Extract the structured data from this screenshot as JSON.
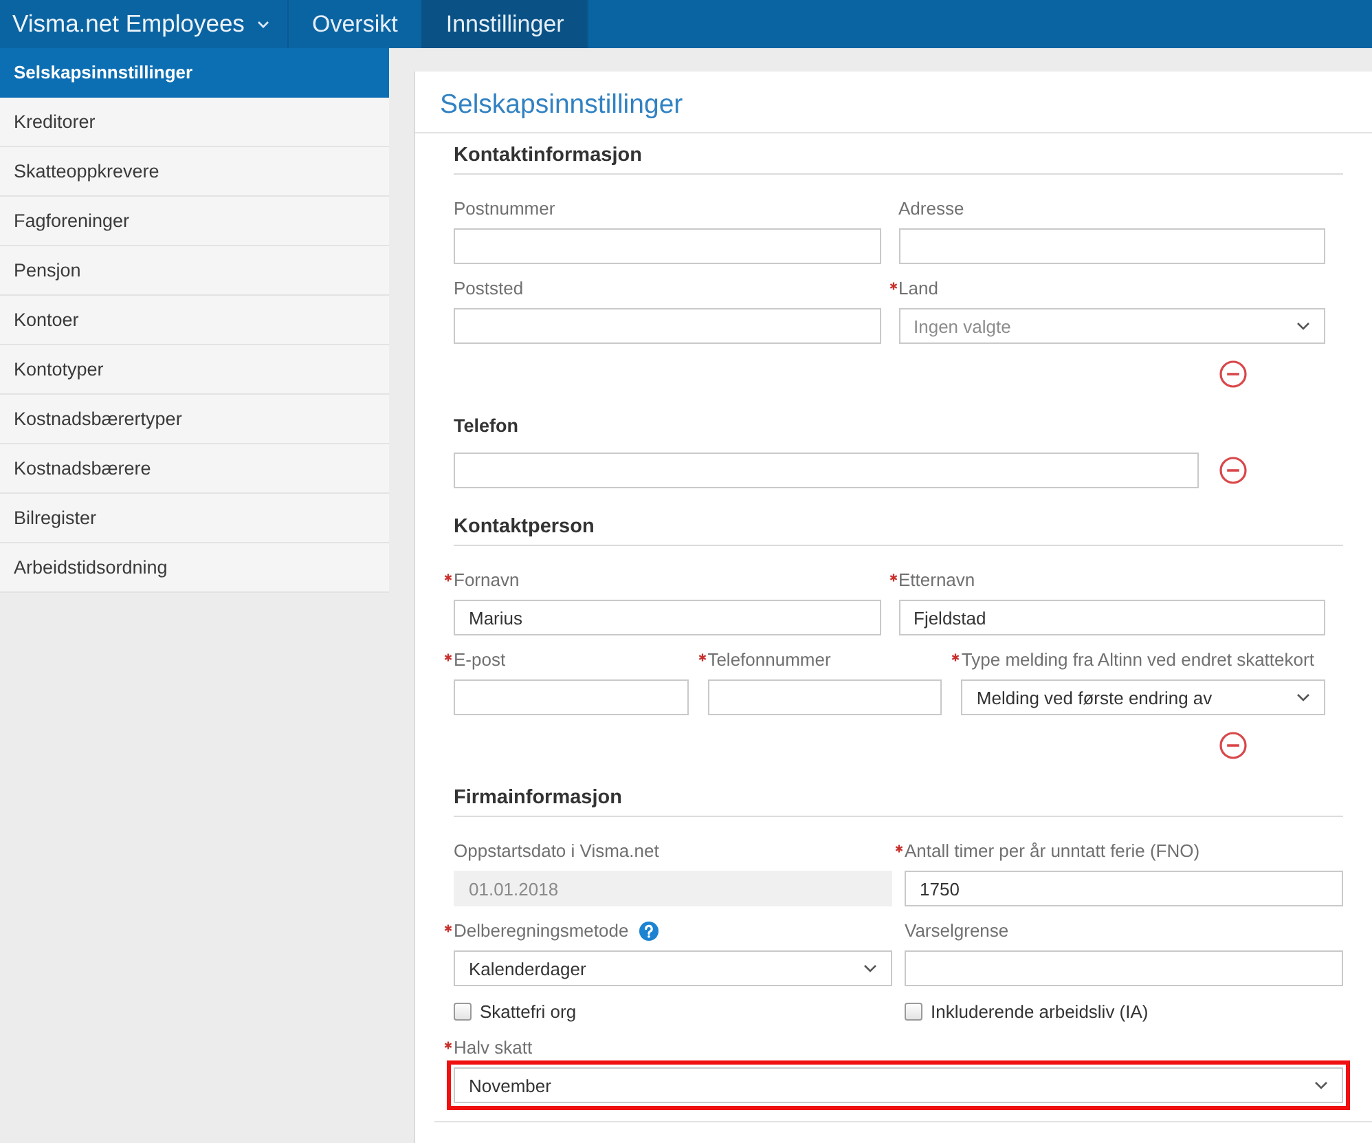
{
  "topbar": {
    "brand": "Visma.net Employees",
    "tabs": [
      {
        "label": "Oversikt",
        "selected": false
      },
      {
        "label": "Innstillinger",
        "selected": true
      }
    ]
  },
  "sidebar": {
    "items": [
      {
        "label": "Selskapsinnstillinger",
        "selected": true
      },
      {
        "label": "Kreditorer",
        "selected": false
      },
      {
        "label": "Skatteoppkrevere",
        "selected": false
      },
      {
        "label": "Fagforeninger",
        "selected": false
      },
      {
        "label": "Pensjon",
        "selected": false
      },
      {
        "label": "Kontoer",
        "selected": false
      },
      {
        "label": "Kontotyper",
        "selected": false
      },
      {
        "label": "Kostnadsbærertyper",
        "selected": false
      },
      {
        "label": "Kostnadsbærere",
        "selected": false
      },
      {
        "label": "Bilregister",
        "selected": false
      },
      {
        "label": "Arbeidstidsordning",
        "selected": false
      }
    ]
  },
  "page": {
    "title": "Selskapsinnstillinger",
    "sections": [
      {
        "kind": "group",
        "heading": "Kontaktinformasjon",
        "rows": [
          {
            "fields": [
              {
                "kind": "input",
                "label": "Postnummer",
                "required": false,
                "disabled": false
              },
              {
                "kind": "input",
                "label": "Adresse",
                "required": false,
                "disabled": false
              }
            ]
          },
          {
            "fields": [
              {
                "kind": "input",
                "label": "Poststed",
                "required": false,
                "disabled": false
              },
              {
                "kind": "select",
                "label": "Land",
                "required": true,
                "disabled": false,
                "placeholder": "Ingen valgte"
              }
            ]
          },
          {
            "fields": [
              {
                "kind": "remove"
              }
            ]
          }
        ]
      },
      {
        "kind": "subgroup",
        "heading": "Telefon",
        "rows": [
          {
            "fields": [
              {
                "kind": "input",
                "disabled": false
              },
              {
                "kind": "remove"
              }
            ]
          }
        ]
      },
      {
        "kind": "group",
        "heading": "Kontaktperson",
        "rows": [
          {
            "fields": [
              {
                "kind": "input",
                "label": "Fornavn",
                "required": true,
                "disabled": false,
                "value": "Marius"
              },
              {
                "kind": "input",
                "label": "Etternavn",
                "required": true,
                "disabled": false,
                "value": "Fjeldstad"
              }
            ]
          },
          {
            "fields": [
              {
                "kind": "input",
                "label": "E-post",
                "required": true,
                "disabled": false
              },
              {
                "kind": "input",
                "label": "Telefonnummer",
                "required": true,
                "disabled": false
              },
              {
                "kind": "select",
                "label": "Type melding fra Altinn ved endret skattekort",
                "required": true,
                "disabled": false,
                "value": "Melding ved første endring av"
              }
            ]
          },
          {
            "fields": [
              {
                "kind": "remove"
              }
            ]
          }
        ]
      },
      {
        "kind": "group",
        "heading": "Firmainformasjon",
        "rows": [
          {
            "fields": [
              {
                "kind": "input",
                "label": "Oppstartsdato i Visma.net",
                "required": false,
                "disabled": true,
                "value": "01.01.2018"
              },
              {
                "kind": "input",
                "label": "Antall timer per år unntatt ferie (FNO)",
                "required": true,
                "disabled": false,
                "value": "1750"
              }
            ]
          },
          {
            "fields": [
              {
                "kind": "select",
                "label": "Delberegningsmetode",
                "required": true,
                "disabled": false,
                "help": true,
                "value": "Kalenderdager"
              },
              {
                "kind": "input",
                "label": "Varselgrense",
                "required": false,
                "disabled": false
              }
            ]
          },
          {
            "fields": [
              {
                "kind": "checkbox",
                "label": "Skattefri org",
                "checked": false
              },
              {
                "kind": "checkbox",
                "label": "Inkluderende arbeidsliv (IA)",
                "checked": false
              }
            ]
          },
          {
            "fields": [
              {
                "kind": "select",
                "label": "Halv skatt",
                "required": true,
                "disabled": false,
                "value": "November",
                "highlighted": true
              }
            ]
          }
        ]
      }
    ]
  }
}
